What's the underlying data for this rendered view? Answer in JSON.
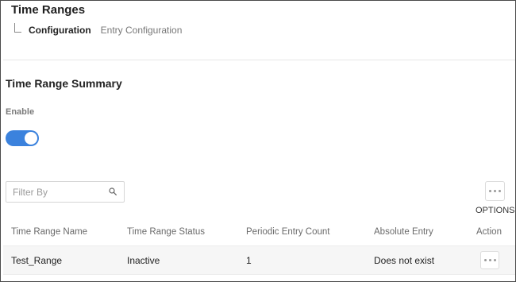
{
  "header": {
    "title": "Time Ranges",
    "breadcrumb": {
      "current": "Configuration",
      "next": "Entry Configuration"
    }
  },
  "summary": {
    "title": "Time Range Summary",
    "enable_label": "Enable",
    "enabled": true
  },
  "filter": {
    "placeholder": "Filter By",
    "value": ""
  },
  "options": {
    "label": "OPTIONS"
  },
  "table": {
    "columns": [
      "Time Range Name",
      "Time Range Status",
      "Periodic Entry Count",
      "Absolute Entry",
      "Action"
    ],
    "rows": [
      {
        "name": "Test_Range",
        "status": "Inactive",
        "periodic_count": "1",
        "absolute_entry": "Does not exist"
      }
    ]
  },
  "colors": {
    "accent": "#3b82dd",
    "row_bg": "#f6f6f6"
  },
  "icons": {
    "search": "search-icon",
    "more": "more-dots-icon",
    "branch": "tree-branch-icon"
  }
}
